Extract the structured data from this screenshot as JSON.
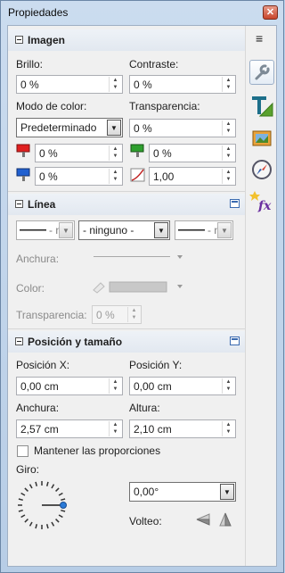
{
  "window": {
    "title": "Propiedades",
    "close_glyph": "✕"
  },
  "tabs": {
    "menu_glyph": "≡",
    "items": [
      {
        "name": "properties",
        "icon": "wrench-icon"
      },
      {
        "name": "styles",
        "icon": "text-style-icon"
      },
      {
        "name": "gallery",
        "icon": "gallery-icon"
      },
      {
        "name": "navigator",
        "icon": "compass-icon"
      },
      {
        "name": "functions",
        "icon": "fx-icon"
      }
    ]
  },
  "image": {
    "title": "Imagen",
    "brillo_label": "Brillo:",
    "brillo_value": "0 %",
    "contraste_label": "Contraste:",
    "contraste_value": "0 %",
    "modo_label": "Modo de color:",
    "modo_value": "Predeterminado",
    "transparencia_label": "Transparencia:",
    "transparencia_value": "0 %",
    "red_value": "0 %",
    "green_value": "0 %",
    "blue_value": "0 %",
    "gamma_value": "1,00",
    "colors": {
      "red": "#e02020",
      "green": "#2fa02f",
      "blue": "#2060d0"
    }
  },
  "line": {
    "title": "Línea",
    "style_value": "- ninguno -",
    "start_arrow_text": "- n",
    "end_arrow_text": "- n",
    "anchura_label": "Anchura:",
    "color_label": "Color:",
    "transparencia_label": "Transparencia:",
    "transparencia_value": "0 %"
  },
  "position": {
    "title": "Posición y tamaño",
    "pos_x_label": "Posición X:",
    "pos_x_value": "0,00 cm",
    "pos_y_label": "Posición Y:",
    "pos_y_value": "0,00 cm",
    "anchura_label": "Anchura:",
    "anchura_value": "2,57 cm",
    "altura_label": "Altura:",
    "altura_value": "2,10 cm",
    "keep_ratio_label": "Mantener las proporciones",
    "keep_ratio_checked": false,
    "giro_label": "Giro:",
    "giro_value": "0,00°",
    "volteo_label": "Volteo:"
  }
}
